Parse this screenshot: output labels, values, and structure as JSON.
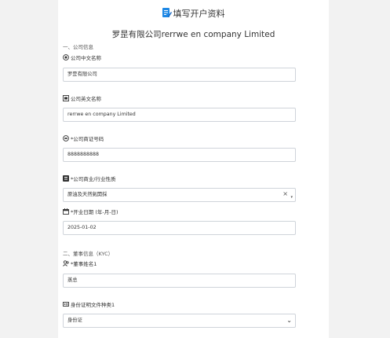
{
  "header": {
    "title": "填写开户资料"
  },
  "company_name": "罗昰有限公司rerrwe en company Limited",
  "section1": {
    "title": "一、公司信息"
  },
  "fields": {
    "cn_name": {
      "label": "公司中文名称",
      "value": "罗昰有限公司"
    },
    "en_name": {
      "label": "公司英文名称",
      "value": "rerrwe en company Limited"
    },
    "br_no": {
      "label": "*公司商证号码",
      "value": "8888888888"
    },
    "industry": {
      "label": "*公司商业/行业性质",
      "value": "原油及天然氣開採",
      "clear": "×",
      "caret": "▾"
    },
    "open_date": {
      "label": "*开业日期 (年-月-日)",
      "value": "2025-01-02"
    }
  },
  "section2": {
    "title": "二、董事信息（KYC）"
  },
  "director": {
    "name_label": "*董事姓名1",
    "name_value": "蒸总",
    "id_type_label": "身份证明文件种类1",
    "id_type_value": "身份证",
    "id_type_chevron": "⌄"
  },
  "colors": {
    "accent": "#1e88e5",
    "border": "#cfd4da",
    "page_bg": "#f2f2f2"
  },
  "icons": [
    "document-edit-icon",
    "target-icon",
    "en-badge-icon",
    "id-badge-icon",
    "industry-icon",
    "calendar-icon",
    "people-icon",
    "id-card-icon"
  ]
}
